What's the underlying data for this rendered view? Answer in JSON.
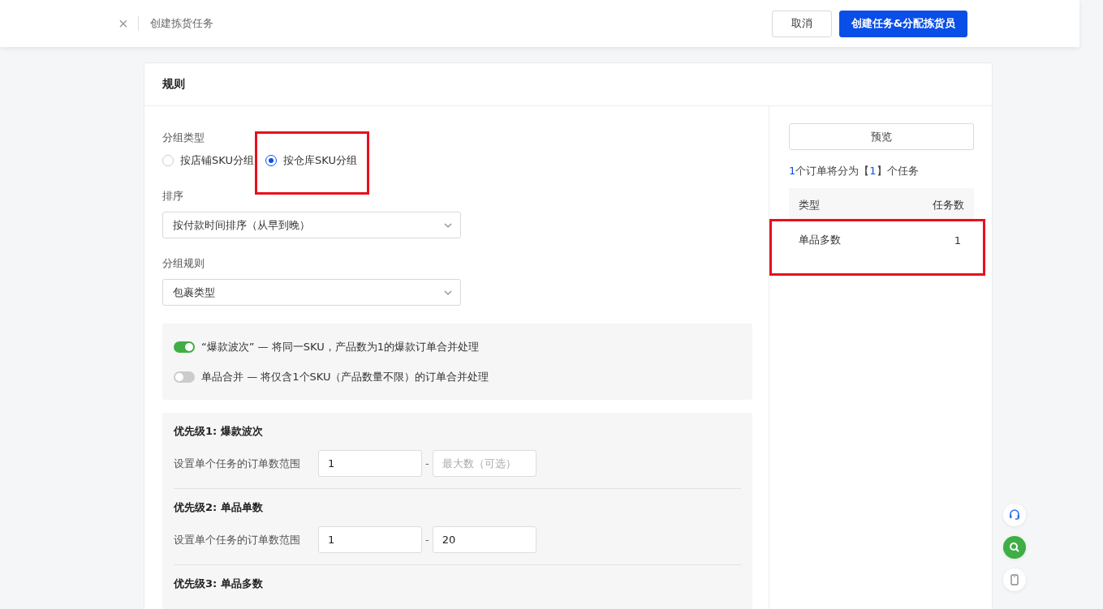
{
  "header": {
    "close": "×",
    "title": "创建拣货任务",
    "buttons": [
      {
        "label": "取消",
        "kind": "secondary"
      },
      {
        "label": "创建任务&分配拣货员",
        "kind": "primary"
      }
    ]
  },
  "card": {
    "title": "规则"
  },
  "group_type": {
    "label": "分组类型",
    "options": [
      {
        "label": "按店铺SKU分组",
        "selected": false,
        "highlighted": false
      },
      {
        "label": "按仓库SKU分组",
        "selected": true,
        "highlighted": true
      }
    ]
  },
  "sort": {
    "label": "排序",
    "value": "按付款时间排序（从早到晚）"
  },
  "group_rule": {
    "label": "分组规则",
    "value": "包裹类型"
  },
  "toggles": [
    {
      "label": "“爆款波次” — 将同一SKU，产品数为1的爆款订单合并处理",
      "on": true
    },
    {
      "label": "单品合并 — 将仅含1个SKU（产品数量不限）的订单合并处理",
      "on": false
    }
  ],
  "priorities": [
    {
      "title": "优先级1: 爆款波次",
      "range_label": "设置单个任务的订单数范围",
      "min": "1",
      "separator": "-",
      "max_placeholder": "最大数（可选）"
    },
    {
      "title": "优先级2: 单品单数",
      "range_label": "设置单个任务的订单数范围",
      "min": "1",
      "separator": "-",
      "max": "20"
    },
    {
      "title": "优先级3: 单品多数"
    }
  ],
  "preview": {
    "button": "预览",
    "summary": [
      {
        "text": "1",
        "accent": true
      },
      {
        "text": "个订单将分为【",
        "accent": false
      },
      {
        "text": "1",
        "accent": true
      },
      {
        "text": "】个任务",
        "accent": false
      }
    ],
    "columns": [
      "类型",
      "任务数"
    ],
    "rows": [
      {
        "type": "单品多数",
        "count": "1",
        "highlighted": true
      }
    ]
  }
}
